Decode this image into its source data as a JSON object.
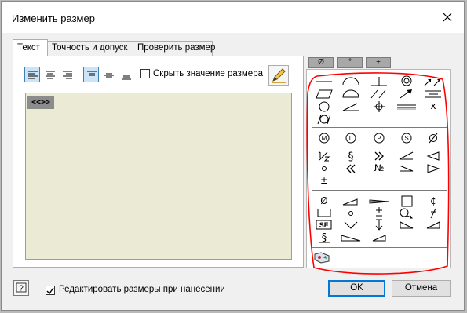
{
  "window": {
    "title": "Изменить размер",
    "close_glyph": "✕"
  },
  "tabs": [
    {
      "label": "Текст",
      "active": true
    },
    {
      "label": "Точность и допуск",
      "active": false
    },
    {
      "label": "Проверить размер",
      "active": false
    }
  ],
  "toolbar": {
    "hide_value_label": "Скрыть значение размера",
    "hide_value_checked": false
  },
  "editor": {
    "content": "<<>>",
    "background": "#ebebd5"
  },
  "symbol_tabs": [
    "Ø",
    "°",
    "±"
  ],
  "symbols": {
    "group3_text": [
      "Ø",
      "№",
      "±",
      "Ø",
      "¢",
      "±"
    ],
    "sf": "SF",
    "x": "x"
  },
  "footer": {
    "edit_on_place_label": "Редактировать размеры при нанесении",
    "edit_on_place_checked": true,
    "ok_label": "OK",
    "cancel_label": "Отмена"
  },
  "colors": {
    "annotation": "#ff0000",
    "focus": "#0078d7"
  }
}
